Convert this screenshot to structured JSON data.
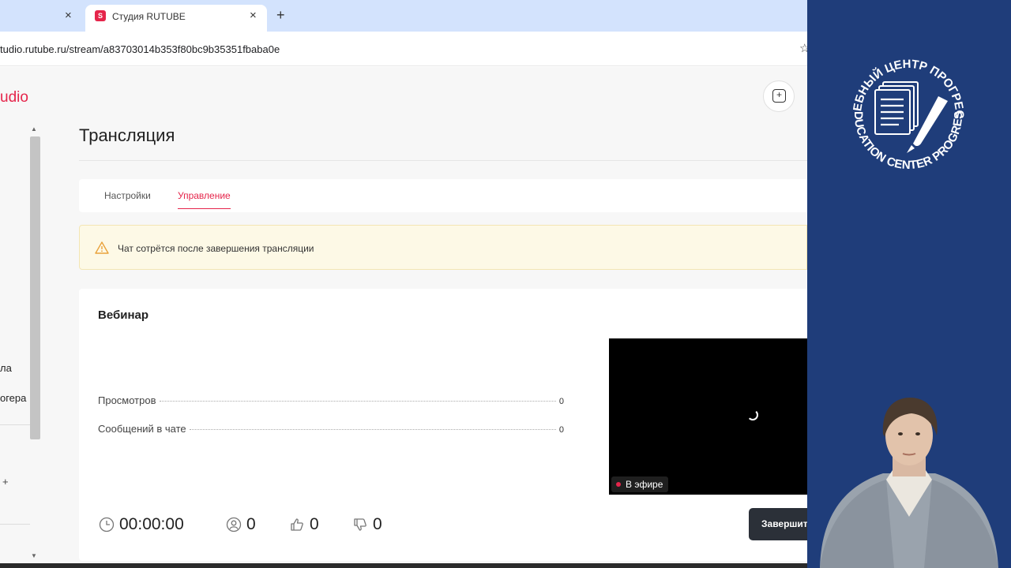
{
  "browser": {
    "tab_inactive_close": "×",
    "tab_active_title": "Студия RUTUBE",
    "tab_active_close": "×",
    "new_tab": "+",
    "url": "tudio.rutube.ru/stream/a83703014b353f80bc9b35351fbaba0e",
    "bookmark_icon": "star-icon"
  },
  "sidebar": {
    "brand": "udio",
    "items": [
      {
        "label": "ла"
      },
      {
        "label": "огера"
      }
    ],
    "plus": "+"
  },
  "page": {
    "title": "Трансляция",
    "tabs": [
      {
        "label": "Настройки",
        "active": false
      },
      {
        "label": "Управление",
        "active": true
      }
    ],
    "warning": {
      "icon": "warning-icon",
      "text": "Чат сотрётся после завершения трансляции"
    }
  },
  "card": {
    "title": "Вебинар",
    "stats": [
      {
        "label": "Просмотров",
        "value": "0"
      },
      {
        "label": "Сообщений в чате",
        "value": "0"
      }
    ],
    "player": {
      "live_label": "В эфире"
    },
    "bottom": {
      "duration": "00:00:00",
      "viewers": "0",
      "likes": "0",
      "dislikes": "0"
    },
    "end_button": "Завершить"
  },
  "overlay": {
    "logo_text_top": "УЧЕБНЫЙ ЦЕНТР ПРОГРЕСС",
    "logo_text_bottom": "EDUCATION CENTER PROGRESS"
  },
  "colors": {
    "accent": "#e5254b",
    "panel": "#1f3d7a",
    "tabbar": "#d3e3fd"
  }
}
